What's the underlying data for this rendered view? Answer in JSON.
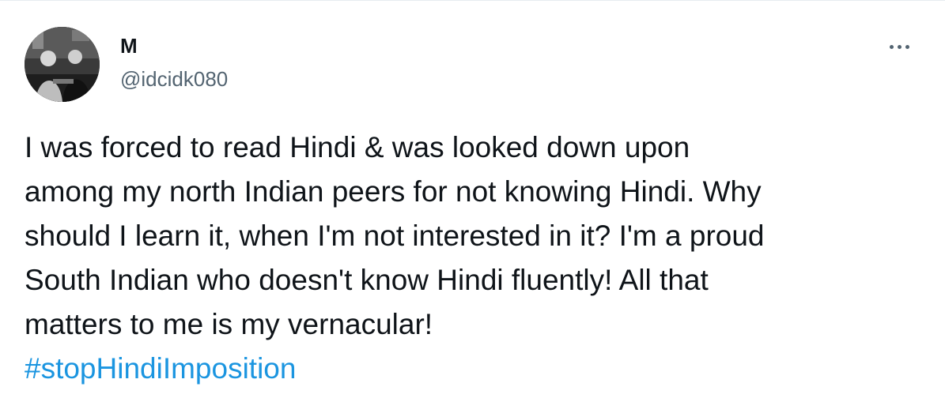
{
  "tweet": {
    "author": {
      "display_name": "M",
      "handle": "@idcidk080"
    },
    "text": "I was forced to read Hindi & was looked down upon\namong my north Indian peers for not knowing Hindi. Why\nshould I learn it, when I'm not interested in it? I'm a proud\nSouth Indian who doesn't know Hindi fluently! All that\nmatters to me is my vernacular!",
    "hashtag": "#stopHindiImposition"
  },
  "icons": {
    "avatar": "profile-photo",
    "more": "more-horizontal-icon"
  },
  "colors": {
    "text": "#0f1419",
    "secondary": "#536471",
    "link": "#1b95e0"
  }
}
